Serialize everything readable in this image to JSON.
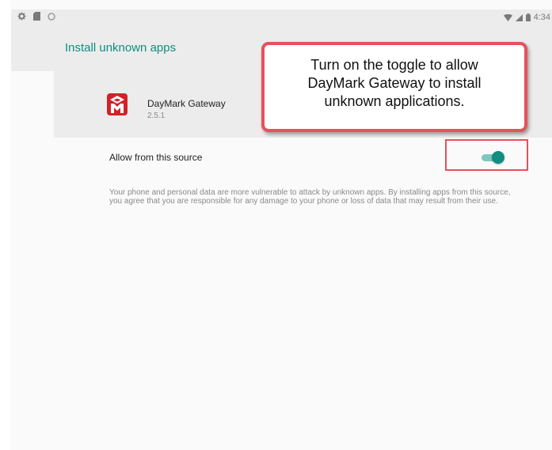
{
  "status_bar": {
    "left_icons": [
      "gear-icon",
      "sd-card-icon",
      "sync-icon"
    ],
    "right_icons": [
      "wifi-icon",
      "signal-icon",
      "battery-icon"
    ],
    "time": "4:34"
  },
  "header": {
    "title": "Install unknown apps"
  },
  "app": {
    "name": "DayMark Gateway",
    "version": "2.5.1",
    "icon": "daymark-logo-icon"
  },
  "setting": {
    "label": "Allow from this source",
    "toggle_on": true
  },
  "description": "Your phone and personal data are more vulnerable to attack by unknown apps. By installing apps from this source, you agree that you are responsible for any damage to your phone or loss of data that may result from their use.",
  "callout": {
    "lines": [
      "Turn on the toggle to allow",
      "DayMark Gateway to install",
      "unknown applications."
    ]
  },
  "colors": {
    "accent": "#0f8d80",
    "annotation": "#e5525b",
    "logo_red": "#d42027"
  }
}
